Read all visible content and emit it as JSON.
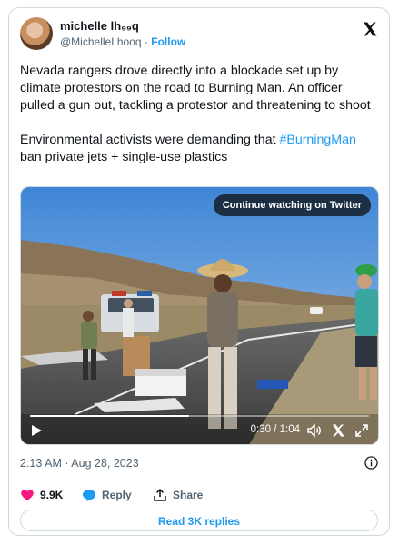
{
  "author": {
    "display_name": "michelle lh₉₉q",
    "handle": "@MichelleLhooq",
    "separator": "·",
    "follow_label": "Follow",
    "avatar_icon": "profile-photo",
    "platform_icon": "x-logo-icon"
  },
  "tweet": {
    "paragraph1": "Nevada rangers drove directly into a blockade set up by climate protestors on the road to Burning Man. An officer pulled a gun out, tackling a protestor and threatening to shoot",
    "paragraph2_prefix": "Environmental activists were demanding that ",
    "hashtag": "#BurningMan",
    "paragraph2_suffix": " ban private jets + single-use plastics"
  },
  "video": {
    "continue_label": "Continue watching on Twitter",
    "time_display": "0:30 / 1:04",
    "progress": 0.47,
    "icons": [
      "play-icon",
      "volume-icon",
      "x-logo-icon",
      "fullscreen-icon"
    ]
  },
  "meta": {
    "timestamp": "2:13 AM · Aug 28, 2023",
    "info_icon": "info-icon"
  },
  "actions": {
    "likes": "9.9K",
    "reply_label": "Reply",
    "share_label": "Share"
  },
  "replies_button": "Read 3K replies",
  "colors": {
    "accent": "#1d9bf0",
    "like": "#f91880",
    "muted": "#536471",
    "border": "#cfd9de"
  }
}
